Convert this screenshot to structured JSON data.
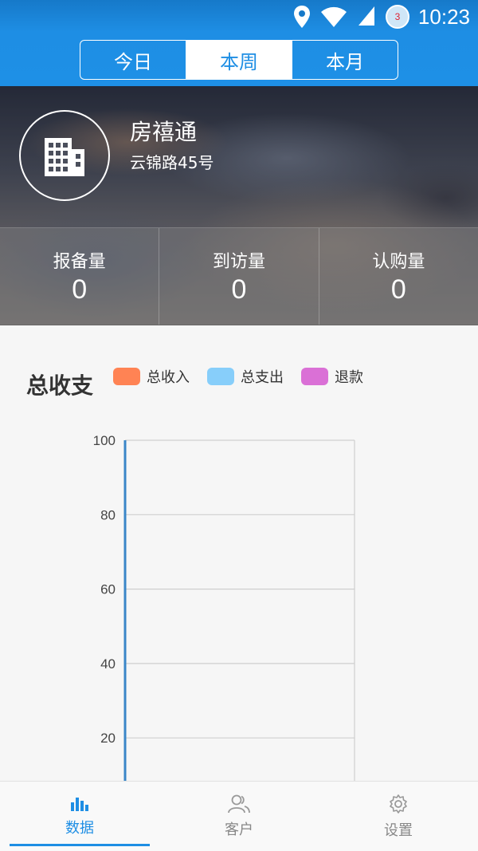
{
  "status": {
    "time": "10:23",
    "notification_count": "3"
  },
  "tabs": [
    {
      "label": "今日",
      "active": false
    },
    {
      "label": "本周",
      "active": true
    },
    {
      "label": "本月",
      "active": false
    }
  ],
  "property": {
    "name": "房禧通",
    "address": "云锦路45号",
    "icon": "building-icon"
  },
  "stats": [
    {
      "label": "报备量",
      "value": "0"
    },
    {
      "label": "到访量",
      "value": "0"
    },
    {
      "label": "认购量",
      "value": "0"
    }
  ],
  "chart_section": {
    "title": "总收支",
    "legend": [
      {
        "label": "总收入",
        "color": "#ff8354"
      },
      {
        "label": "总支出",
        "color": "#87cefa"
      },
      {
        "label": "退款",
        "color": "#da70d6"
      }
    ]
  },
  "chart_data": {
    "type": "line",
    "title": "总收支",
    "series": [
      {
        "name": "总收入",
        "values": []
      },
      {
        "name": "总支出",
        "values": []
      },
      {
        "name": "退款",
        "values": []
      }
    ],
    "y_ticks": [
      "100",
      "80",
      "60",
      "40",
      "20"
    ],
    "ylim": [
      0,
      100
    ],
    "grid": true
  },
  "nav": [
    {
      "label": "数据",
      "icon": "bar-chart-icon",
      "active": true
    },
    {
      "label": "客户",
      "icon": "users-icon",
      "active": false
    },
    {
      "label": "设置",
      "icon": "gear-icon",
      "active": false
    }
  ],
  "colors": {
    "primary": "#1e8ee4",
    "income": "#ff8354",
    "expense": "#87cefa",
    "refund": "#da70d6"
  }
}
